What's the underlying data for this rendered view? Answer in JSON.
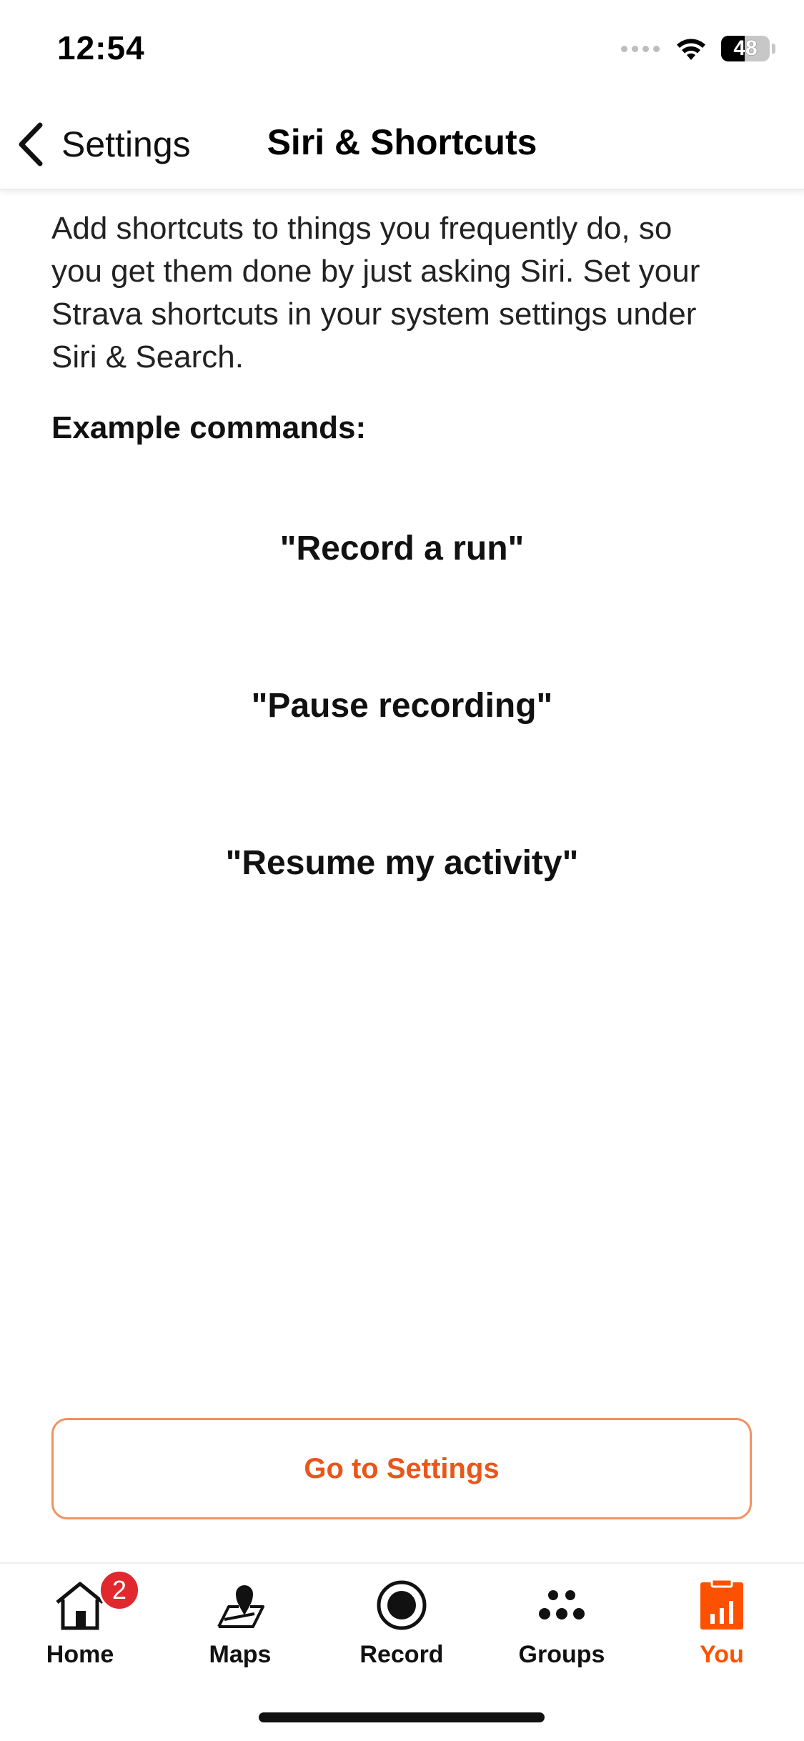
{
  "status_bar": {
    "time": "12:54",
    "battery_level": "48",
    "battery_fraction": 0.48
  },
  "nav": {
    "back_label": "Settings",
    "title": "Siri & Shortcuts"
  },
  "content": {
    "description": "Add shortcuts to things you frequently do, so you get them done by just asking Siri. Set your Strava shortcuts in your system settings under Siri & Search.",
    "example_heading": "Example commands:",
    "commands": [
      "\"Record a run\"",
      "\"Pause recording\"",
      "\"Resume my activity\""
    ]
  },
  "settings_button": {
    "label": "Go to Settings"
  },
  "tab_bar": {
    "tabs": [
      {
        "label": "Home",
        "icon": "home-icon",
        "badge": "2"
      },
      {
        "label": "Maps",
        "icon": "maps-icon"
      },
      {
        "label": "Record",
        "icon": "record-icon"
      },
      {
        "label": "Groups",
        "icon": "groups-icon"
      },
      {
        "label": "You",
        "icon": "you-icon",
        "active": true
      }
    ]
  },
  "colors": {
    "accent": "#fc5200",
    "button_border": "#f29162",
    "badge": "#e0282e"
  }
}
